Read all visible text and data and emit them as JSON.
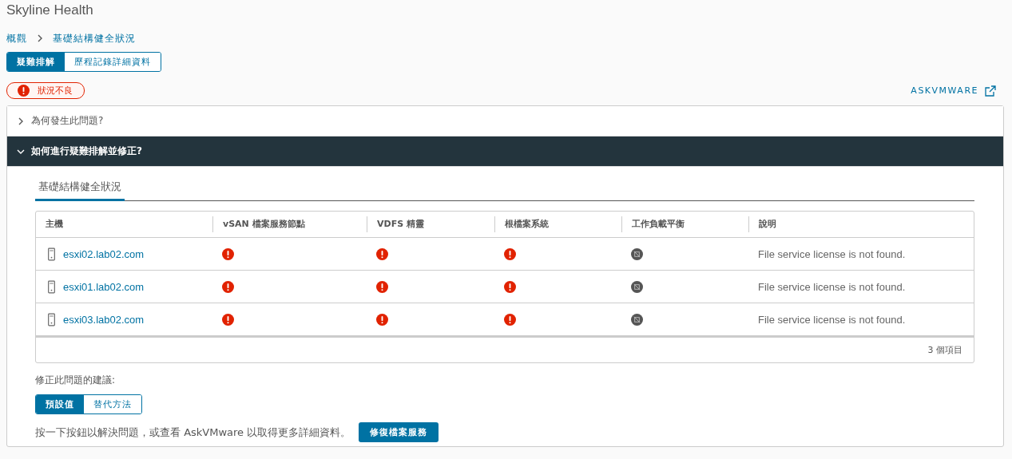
{
  "page_title": "Skyline Health",
  "breadcrumb": [
    {
      "label": "概觀"
    },
    {
      "label": "基礎結構健全狀況"
    }
  ],
  "view_tabs": [
    {
      "label": "疑難排解",
      "selected": true
    },
    {
      "label": "歷程記錄詳細資料",
      "selected": false
    }
  ],
  "status_badge": {
    "label": "狀況不良",
    "kind": "error"
  },
  "help_link": "ASKVMWARE",
  "accordion": [
    {
      "title": "為何發生此問題?",
      "expanded": false
    },
    {
      "title": "如何進行疑難排解並修正?",
      "expanded": true
    }
  ],
  "inner_tabs": [
    {
      "label": "基礎結構健全狀況",
      "selected": true
    }
  ],
  "table": {
    "columns": [
      "主機",
      "vSAN 檔案服務節點",
      "VDFS 精靈",
      "根檔案系統",
      "工作負載平衡",
      "說明"
    ],
    "rows": [
      {
        "host": "esxi02.lab02.com",
        "statuses": [
          {
            "kind": "error"
          },
          {
            "kind": "error"
          },
          {
            "kind": "error"
          },
          {
            "kind": "disabled"
          }
        ],
        "description": "File service license is not found."
      },
      {
        "host": "esxi01.lab02.com",
        "statuses": [
          {
            "kind": "error"
          },
          {
            "kind": "error"
          },
          {
            "kind": "error"
          },
          {
            "kind": "disabled"
          }
        ],
        "description": "File service license is not found."
      },
      {
        "host": "esxi03.lab02.com",
        "statuses": [
          {
            "kind": "error"
          },
          {
            "kind": "error"
          },
          {
            "kind": "error"
          },
          {
            "kind": "disabled"
          }
        ],
        "description": "File service license is not found."
      }
    ],
    "footer": "3 個項目"
  },
  "fix_label": "修正此問題的建議:",
  "fix_tabs": [
    {
      "label": "預設值",
      "selected": true
    },
    {
      "label": "替代方法",
      "selected": false
    }
  ],
  "fix_text": "按一下按鈕以解決問題，或查看 AskVMware 以取得更多詳細資料。",
  "fix_button": "修復檔案服務"
}
